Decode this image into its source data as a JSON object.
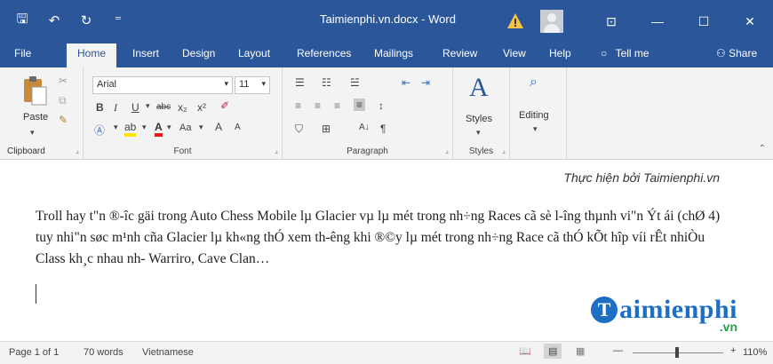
{
  "window": {
    "title": "Taimienphi.vn.docx  -  Word",
    "minimize_glyph": "—",
    "maximize_glyph": "☐",
    "close_glyph": "✕",
    "restore_glyph": "⊡",
    "save_glyph": "🖫",
    "undo_glyph": "↶",
    "redo_glyph": "↻",
    "qat_glyph": "⁼"
  },
  "tabs": {
    "file": "File",
    "home": "Home",
    "insert": "Insert",
    "design": "Design",
    "layout": "Layout",
    "references": "References",
    "mailings": "Mailings",
    "review": "Review",
    "view": "View",
    "help": "Help",
    "tell_me": "Tell me",
    "share": "Share"
  },
  "ribbon": {
    "clipboard": {
      "label": "Clipboard",
      "paste": "Paste"
    },
    "font": {
      "label": "Font",
      "font_name": "Arial",
      "font_size": "11",
      "bold": "B",
      "italic": "I",
      "underline": "U",
      "strike": "abc",
      "subscript": "x₂",
      "superscript": "x²",
      "font_color": "A",
      "change_case": "Aa",
      "grow": "A",
      "shrink": "A"
    },
    "paragraph": {
      "label": "Paragraph",
      "sort": "A↓",
      "pilcrow": "¶"
    },
    "styles": {
      "label": "Styles",
      "button": "Styles"
    },
    "editing": {
      "button": "Editing"
    }
  },
  "document": {
    "credit": "Thực hiện bởi Taimienphi.vn",
    "paragraph": "Troll hay t\"n ®-îc gäi trong Auto Chess Mobile lµ Glacier vµ lµ mét trong nh÷ng Races cã sè l-îng thµnh vi\"n Ýt ái (chØ 4) tuy nhi\"n søc m¹nh cña Glacier lµ kh«ng thÓ xem th-êng khi ®©y lµ mét trong nh÷ng Race cã thÓ kÕt hîp víi rÊt nhiÒu Class kh¸c nhau nh- Warriro, Cave Clan…"
  },
  "watermark": {
    "initial": "T",
    "text": "aimienphi",
    "suffix": ".vn"
  },
  "status": {
    "page": "Page 1 of 1",
    "words": "70 words",
    "language": "Vietnamese",
    "zoom": "110%",
    "minus": "—",
    "plus": "+"
  },
  "colors": {
    "accent": "#2b579a",
    "watermark_blue": "#1d6fc3",
    "watermark_green": "#2aa04b"
  }
}
